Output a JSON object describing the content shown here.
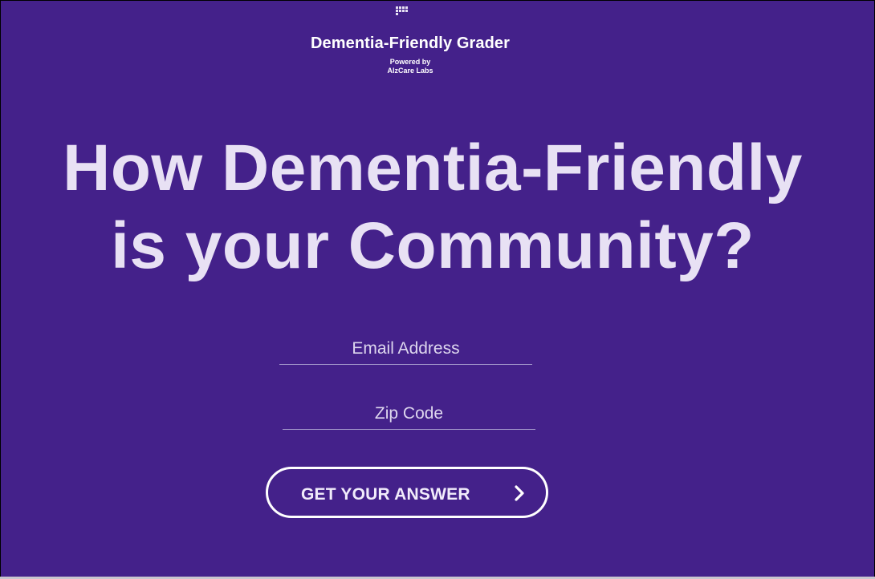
{
  "header": {
    "app_title": "Dementia-Friendly Grader",
    "powered_by_line1": "Powered by",
    "powered_by_line2": "AlzCare Labs",
    "menu_icon": "grid-icon"
  },
  "hero": {
    "headline_line1": "How Dementia-Friendly",
    "headline_line2": "is your Community?"
  },
  "form": {
    "email": {
      "placeholder": "Email Address",
      "value": ""
    },
    "zip": {
      "placeholder": "Zip Code",
      "value": ""
    },
    "submit": {
      "label": "GET YOUR ANSWER",
      "icon": "chevron-right-icon"
    }
  },
  "colors": {
    "background": "#44218a",
    "headline": "#e8e1f4",
    "text": "#ffffff",
    "field_underline": "#9c8fc6"
  }
}
